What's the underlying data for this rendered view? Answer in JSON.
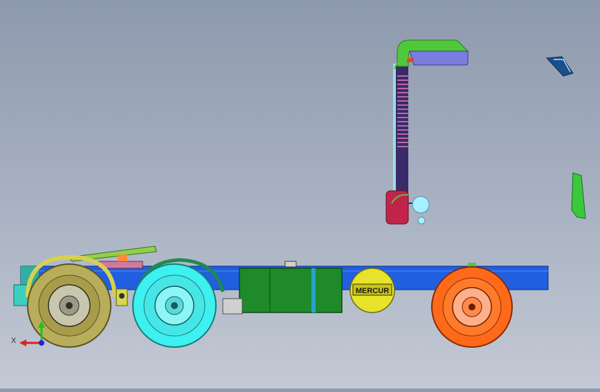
{
  "viewport": {
    "background_top": "#8d99ad",
    "background_bottom": "#c3c9d4"
  },
  "model": {
    "tank_badge_text": "MERCUR",
    "colors": {
      "frame": "#1f5fe0",
      "fuel_tank": "#1e8a2a",
      "rear_tire": "#b8ad5a",
      "middle_tire": "#3ef0f0",
      "front_tire": "#ff6a1a",
      "exhaust_pipe": "#3a2a6a",
      "exhaust_elbow": "#4fc83c",
      "exhaust_outlet": "#7c7ce0",
      "muffler": "#c0244a",
      "fifth_wheel": "#8fd048",
      "badge_disk": "#e7e22a"
    }
  },
  "triad": {
    "x_label": "X",
    "x_color": "#e02020",
    "y_color": "#20c020",
    "z_color": "#2020e0"
  }
}
